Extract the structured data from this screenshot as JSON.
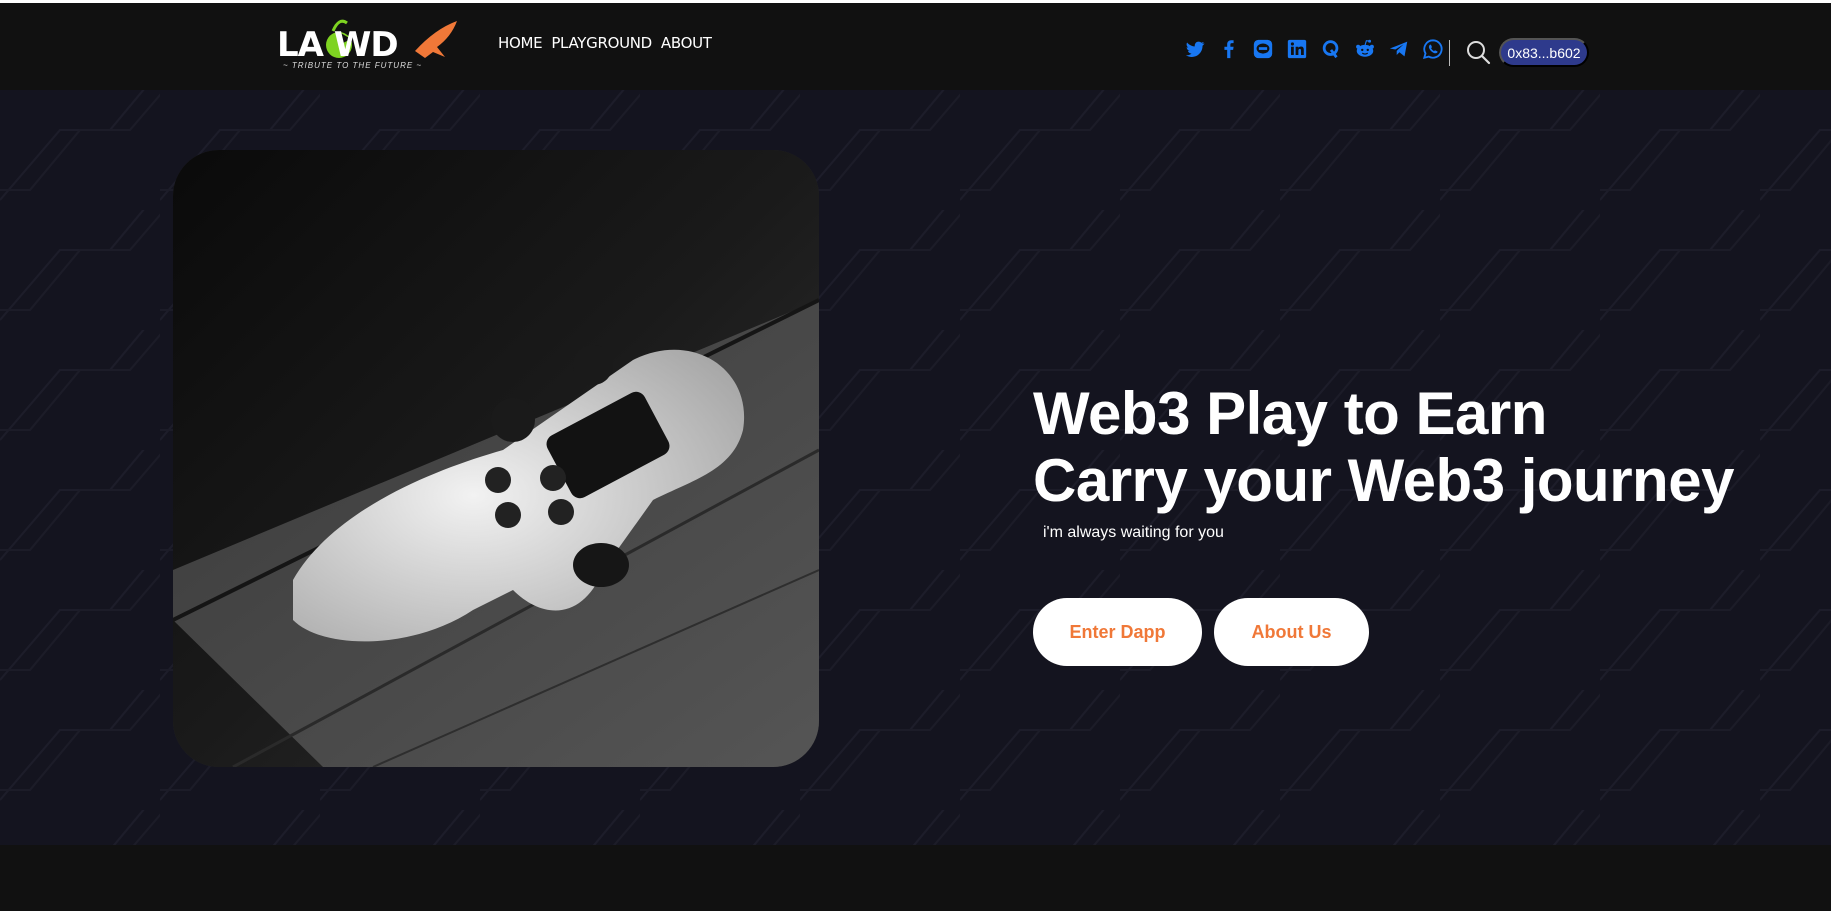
{
  "logo": {
    "text": "LA WD",
    "subtitle": "~ TRIBUTE TO THE FUTURE ~"
  },
  "nav": {
    "items": [
      "HOME",
      "PLAYGROUND",
      "ABOUT"
    ]
  },
  "socials": [
    "twitter-icon",
    "facebook-icon",
    "line-icon",
    "linkedin-icon",
    "quora-icon",
    "reddit-icon",
    "telegram-icon",
    "whatsapp-icon"
  ],
  "colors": {
    "accent": "#1877f2",
    "button_text": "#f07838",
    "wallet_bg": "#2e3a8c",
    "hero_bg": "#14141f"
  },
  "wallet": {
    "address": "0x83...b602"
  },
  "hero": {
    "line1": "Web3 Play to Earn",
    "line2": "Carry your Web3 journey",
    "tagline": "i'm always waiting for you",
    "enter_label": "Enter Dapp",
    "about_label": "About Us"
  }
}
